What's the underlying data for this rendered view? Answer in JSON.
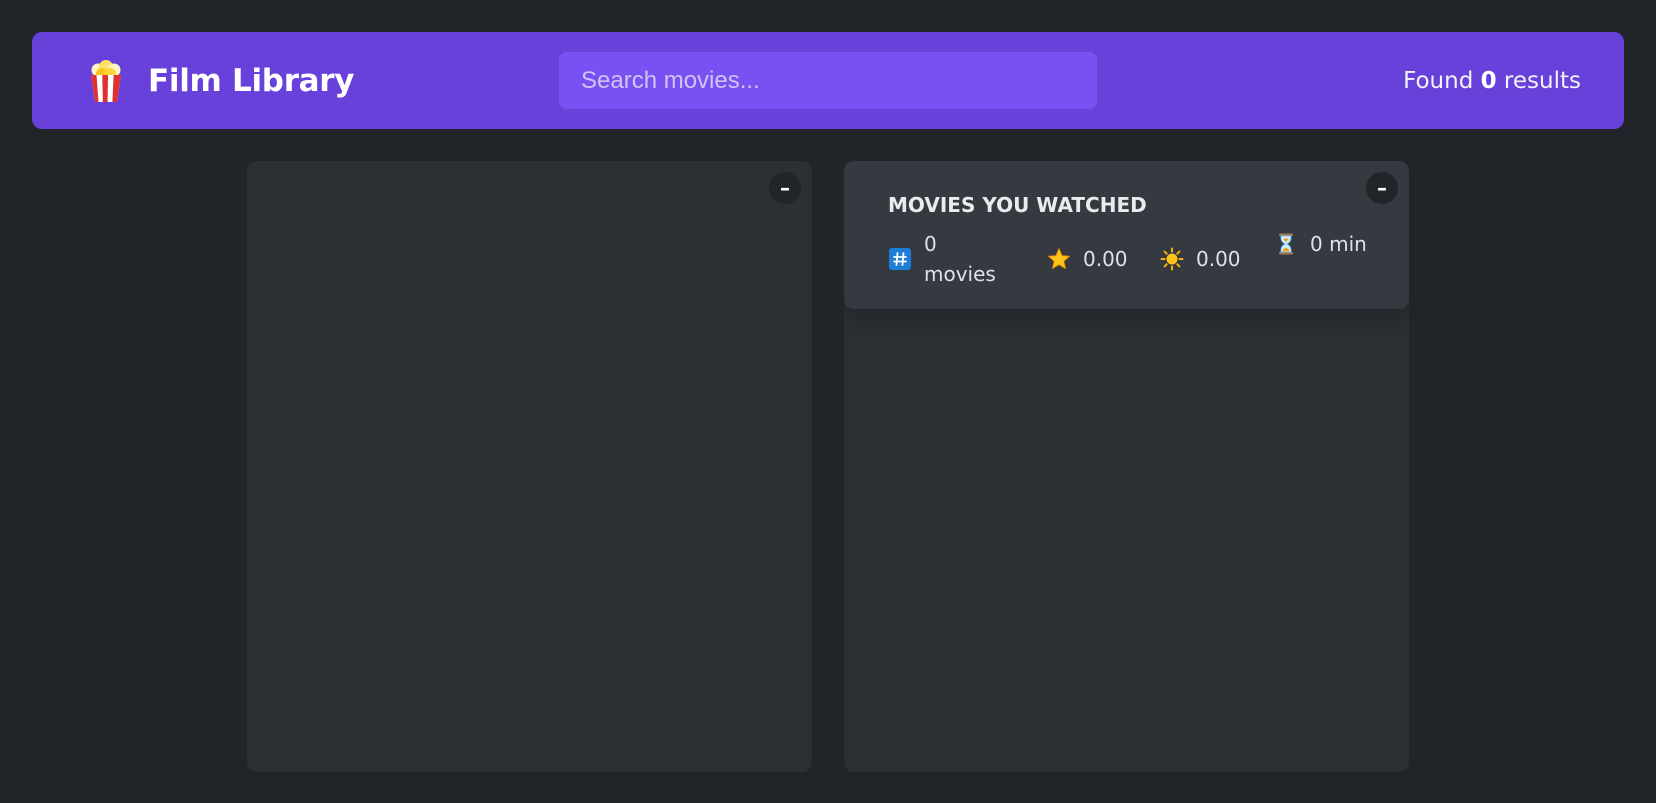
{
  "header": {
    "logo_icon": "popcorn-icon",
    "title": "Film Library",
    "search": {
      "placeholder": "Search movies...",
      "value": ""
    },
    "results": {
      "prefix": "Found ",
      "count": "0",
      "suffix": " results"
    }
  },
  "search_results_box": {
    "toggle_label": "–",
    "items": []
  },
  "watched_box": {
    "toggle_label": "–",
    "summary": {
      "heading": "Movies you watched",
      "num_movies": {
        "icon": "hash-icon",
        "text": "0 movies"
      },
      "imdb_rating": {
        "icon": "star-icon",
        "text": "0.00"
      },
      "user_rating": {
        "icon": "sun-icon",
        "text": "0.00"
      },
      "runtime": {
        "icon": "hourglass-icon",
        "text": "0 min"
      }
    },
    "items": []
  },
  "colors": {
    "background": "#212529",
    "nav_bar": "#6741d9",
    "search_bg": "#7950f2",
    "box_bg": "#2b3035",
    "summary_bg": "#343a40",
    "toggle_bg": "#212529",
    "text": "#dee2e6"
  }
}
